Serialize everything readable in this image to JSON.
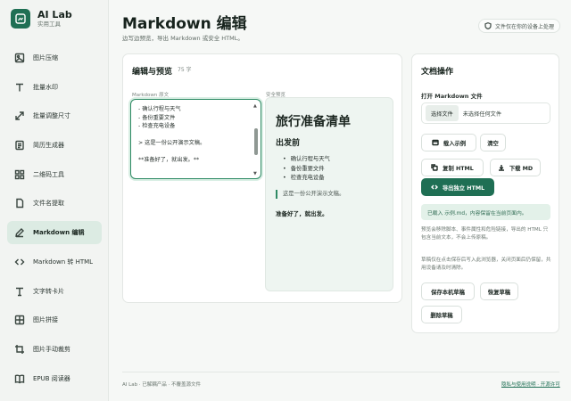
{
  "brand": {
    "name": "AI Lab",
    "subtitle": "实用工具"
  },
  "nav": [
    {
      "label": "图片压缩",
      "icon": "image-icon"
    },
    {
      "label": "批量水印",
      "icon": "text-icon"
    },
    {
      "label": "批量调整尺寸",
      "icon": "resize-icon"
    },
    {
      "label": "简历生成器",
      "icon": "document-icon"
    },
    {
      "label": "二维码工具",
      "icon": "grid-icon"
    },
    {
      "label": "文件名提取",
      "icon": "file-icon"
    },
    {
      "label": "Markdown 编辑",
      "icon": "pen-icon",
      "active": true
    },
    {
      "label": "Markdown 转 HTML",
      "icon": "code-icon"
    },
    {
      "label": "文字转卡片",
      "icon": "text-card-icon"
    },
    {
      "label": "图片拼接",
      "icon": "collage-icon"
    },
    {
      "label": "图片手动裁剪",
      "icon": "crop-icon"
    },
    {
      "label": "EPUB 阅读器",
      "icon": "book-icon"
    }
  ],
  "header": {
    "title": "Markdown 编辑",
    "subtitle": "边写边预览，导出 Markdown 或安全 HTML。",
    "privacy_badge": "文件仅在你的设备上处理"
  },
  "editor": {
    "title": "编辑与预览",
    "word_count": "75 字",
    "source_label": "Markdown 原文",
    "preview_label": "安全预览",
    "source_text": "- 确认行程与天气\n- 备份重要文件\n- 检查充电设备\n\n> 这是一份公开演示文稿。\n\n**准备好了，就出发。**"
  },
  "preview": {
    "h1": "旅行准备清单",
    "h2": "出发前",
    "items": [
      "确认行程与天气",
      "备份重要文件",
      "检查充电设备"
    ],
    "quote": "这是一份公开演示文稿。",
    "bold": "准备好了，就出发。"
  },
  "ops": {
    "title": "文档操作",
    "open_label": "打开 Markdown 文件",
    "choose_file": "选择文件",
    "no_file": "未选择任何文件",
    "load_sample": "载入示例",
    "clear": "清空",
    "copy_html": "复制 HTML",
    "download_md": "下载 MD",
    "export_html": "导出独立 HTML",
    "notice": "已载入 示例.md，内容保留在当前页面内。",
    "help1": "预览会移除脚本、事件属性和危险链接，导出的 HTML 只包含当前文本，不会上传原稿。",
    "help2": "草稿仅在点击保存后写入此浏览器，关闭页面后仍保留，共用设备请及时清除。",
    "save_draft": "保存本机草稿",
    "restore_draft": "恢复草稿",
    "delete_draft": "删除草稿"
  },
  "footer": {
    "left": "AI Lab · 已解耦产品 · 不覆盖源文件",
    "right": "隐私与使用说明 · 开源许可"
  }
}
